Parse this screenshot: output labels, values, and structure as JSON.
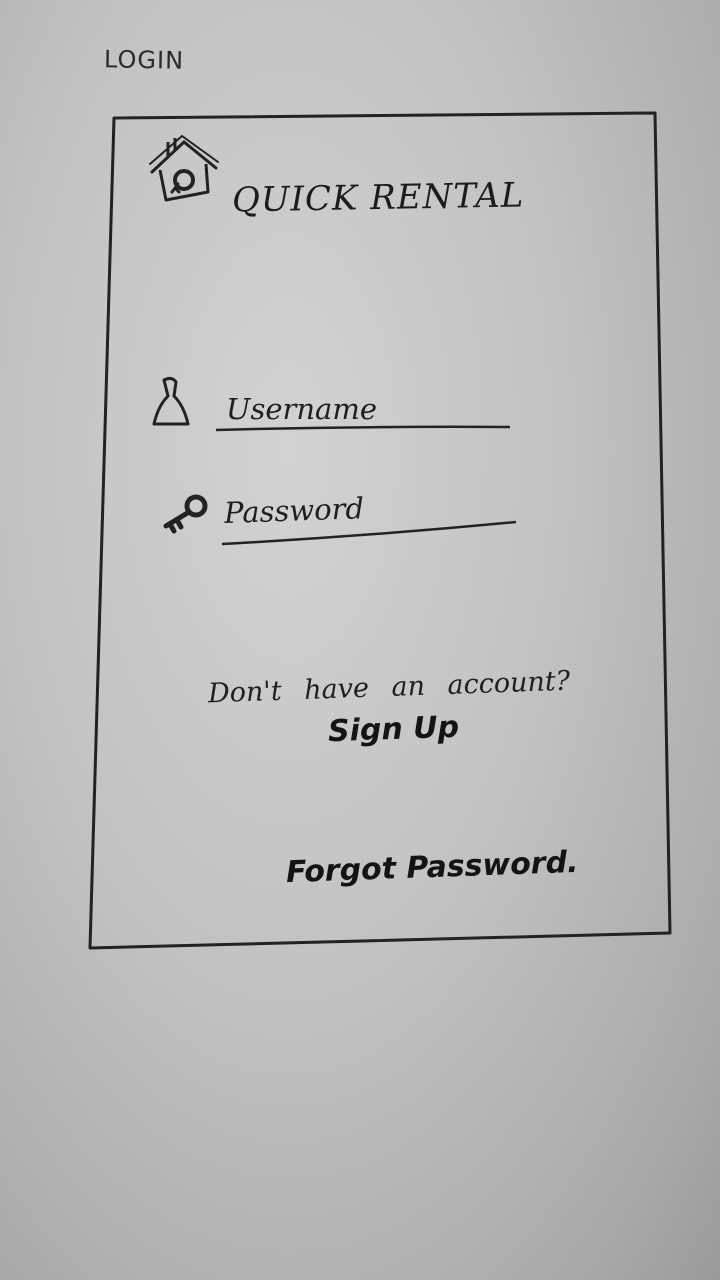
{
  "page": {
    "title": "LOGIN"
  },
  "app": {
    "name": "QUICK RENTAL",
    "logo_icon": "house-key-icon"
  },
  "form": {
    "username": {
      "placeholder": "Username",
      "value": "",
      "icon": "user-icon"
    },
    "password": {
      "placeholder": "Password",
      "value": "",
      "icon": "key-icon"
    }
  },
  "signup": {
    "prompt": "Don't have an account?",
    "link_label": "Sign Up"
  },
  "forgot": {
    "link_label": "Forgot Password."
  },
  "colors": {
    "paper": "#c4c4c4",
    "ink": "#1b1b1b"
  }
}
